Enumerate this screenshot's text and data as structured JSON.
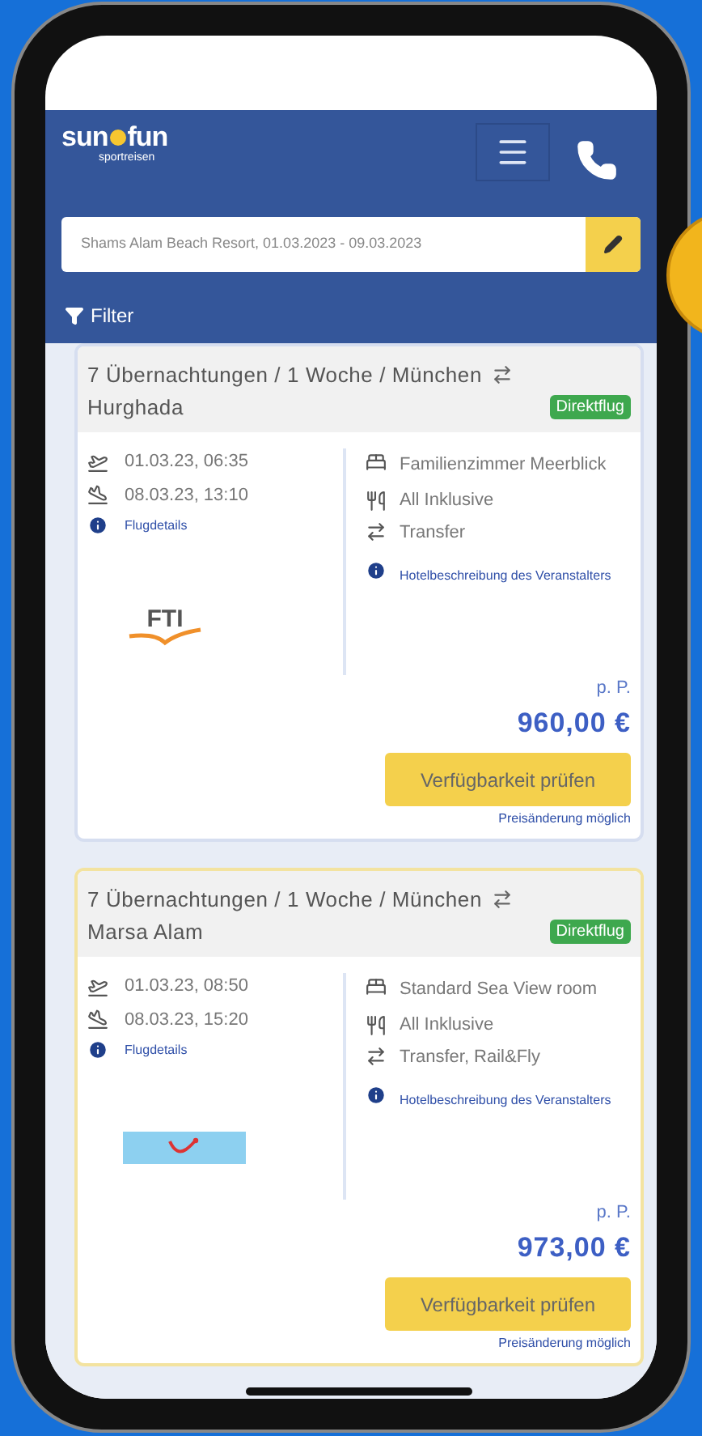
{
  "header": {
    "logo": {
      "left": "sun",
      "right": "fun",
      "tagline": "sportreisen"
    },
    "search": {
      "value": "Shams Alam Beach Resort, 01.03.2023 - 09.03.2023"
    },
    "filter": "Filter"
  },
  "offers": [
    {
      "highlighted": false,
      "title": "7 Übernachtungen / 1 Woche  / München",
      "destination": "Hurghada",
      "badge": "Direktflug",
      "outbound": "01.03.23, 06:35",
      "return": "08.03.23, 13:10",
      "flight_link": "Flugdetails",
      "operator": {
        "kind": "fti",
        "text": "FTI"
      },
      "room": "Familienzimmer Meerblick",
      "board": "All Inklusive",
      "transfer": "Transfer",
      "hotel_link": "Hotelbeschreibung des Veranstalters",
      "per_person": "p. P.",
      "price": "960,00 €",
      "button": "Verfügbarkeit prüfen",
      "note": "Preisänderung möglich"
    },
    {
      "highlighted": true,
      "title": "7 Übernachtungen / 1 Woche  / München",
      "destination": "Marsa Alam",
      "badge": "Direktflug",
      "outbound": "01.03.23, 08:50",
      "return": "08.03.23, 15:20",
      "flight_link": "Flugdetails",
      "operator": {
        "kind": "tui"
      },
      "room": "Standard Sea View room",
      "board": "All Inklusive",
      "transfer": "Transfer, Rail&Fly",
      "hotel_link": "Hotelbeschreibung des Veranstalters",
      "per_person": "p. P.",
      "price": "973,00 €",
      "button": "Verfügbarkeit prüfen",
      "note": "Preisänderung möglich"
    }
  ]
}
